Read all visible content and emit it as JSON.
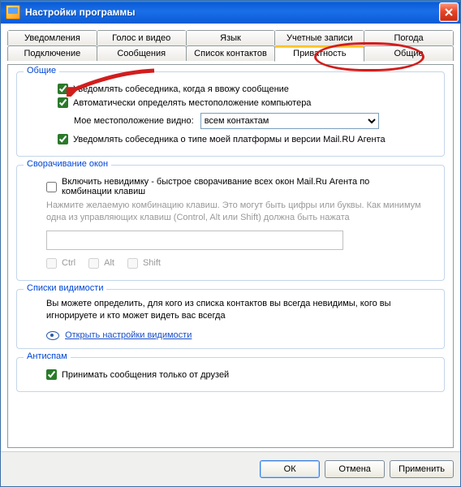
{
  "window": {
    "title": "Настройки программы"
  },
  "tabs": {
    "row1": [
      {
        "label": "Уведомления"
      },
      {
        "label": "Голос и видео"
      },
      {
        "label": "Язык"
      },
      {
        "label": "Учетные записи"
      },
      {
        "label": "Погода"
      }
    ],
    "row2": [
      {
        "label": "Подключение"
      },
      {
        "label": "Сообщения"
      },
      {
        "label": "Список контактов"
      },
      {
        "label": "Приватность",
        "active": true
      },
      {
        "label": "Общие"
      }
    ]
  },
  "groups": {
    "general": {
      "title": "Общие",
      "notify_typing": "Уведомлять собеседника, когда я ввожу сообщение",
      "auto_location": "Автоматически определять местоположение компьютера",
      "location_label": "Мое местоположение видно:",
      "location_value": "всем контактам",
      "notify_platform": "Уведомлять собеседника о типе моей платформы и версии Mail.RU Агента"
    },
    "minimize": {
      "title": "Сворачивание окон",
      "invisible": "Включить невидимку - быстрое сворачивание всех окон Mail.Ru Агента по комбинации клавиш",
      "hint": "Нажмите желаемую комбинацию клавиш. Это могут быть цифры или буквы. Как минимум одна из управляющих клавиш (Control, Alt или Shift) должна быть нажата",
      "ctrl": "Ctrl",
      "alt": "Alt",
      "shift": "Shift"
    },
    "visibility": {
      "title": "Списки видимости",
      "text": "Вы можете определить, для кого из списка контактов вы всегда невидимы, кого вы игнорируете и кто может видеть вас всегда",
      "link": "Открыть настройки видимости"
    },
    "antispam": {
      "title": "Антиспам",
      "friends_only": "Принимать сообщения только от друзей"
    }
  },
  "buttons": {
    "ok": "ОК",
    "cancel": "Отмена",
    "apply": "Применить"
  }
}
